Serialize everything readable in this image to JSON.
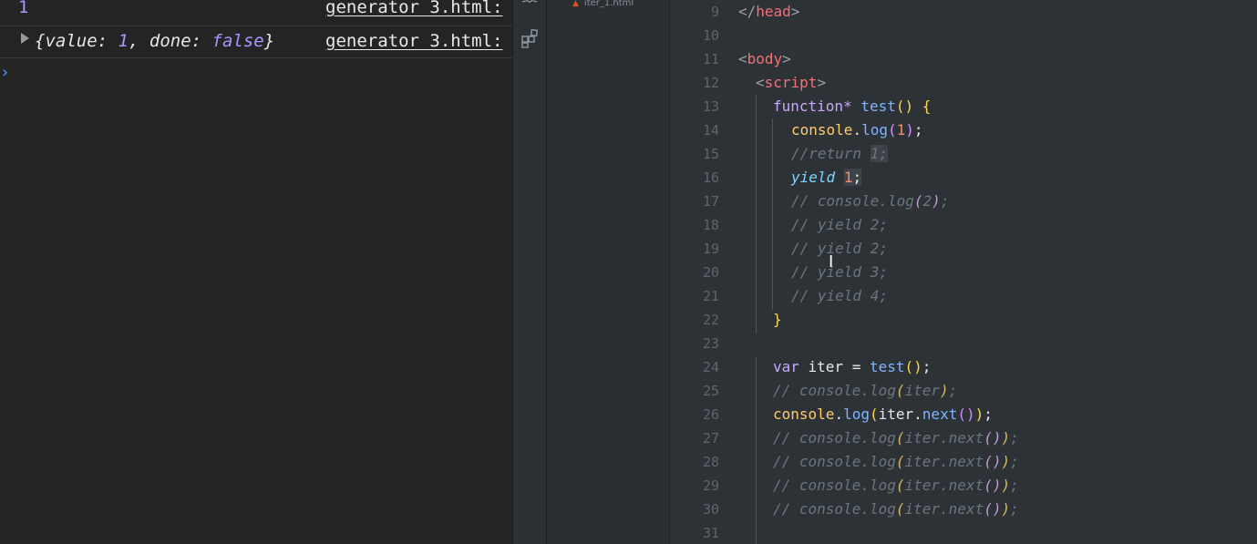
{
  "console": {
    "rows": [
      {
        "type": "number",
        "value": "1",
        "source": "generator 3.html:"
      },
      {
        "type": "object",
        "open": "{",
        "k1": "value: ",
        "v1": "1",
        "sep": ", ",
        "k2": "done: ",
        "v2": "false",
        "close": "}",
        "source": "generator 3.html:"
      }
    ],
    "prompt": "›"
  },
  "explorer": {
    "file_name": "iter_1.html",
    "file_icon": "html5-file-icon"
  },
  "activity_icons": [
    "debug-icon",
    "extensions-icon"
  ],
  "editor": {
    "line_numbers": [
      "9",
      "10",
      "11",
      "12",
      "13",
      "14",
      "15",
      "16",
      "17",
      "18",
      "19",
      "20",
      "21",
      "22",
      "23",
      "24",
      "25",
      "26",
      "27",
      "28",
      "29",
      "30",
      "31"
    ],
    "lines": {
      "l9": {
        "a": "</",
        "b": "head",
        "c": ">"
      },
      "l11": {
        "a": "<",
        "b": "body",
        "c": ">"
      },
      "l12": {
        "a": "<",
        "b": "script",
        "c": ">"
      },
      "l13": {
        "kw": "function* ",
        "fn": "test",
        "p": "()",
        "sp": " ",
        "br": "{"
      },
      "l14": {
        "obj": "console",
        "dot": ".",
        "fn": "log",
        "p1": "(",
        "n": "1",
        "p2": ")",
        "end": ";"
      },
      "l15": {
        "c": "//return ",
        "h": "1;"
      },
      "l16": {
        "y": "yield",
        "sp": " ",
        "n": "1",
        "end": ";"
      },
      "l17": {
        "c1": "// console.log",
        "p1": "(",
        "c2": "2",
        "p2": ")",
        "c3": ";"
      },
      "l18": {
        "c": "// yield 2;"
      },
      "l19": {
        "c": "// yield 2;"
      },
      "l20": {
        "c": "// yield 3;"
      },
      "l21": {
        "c": "// yield 4;"
      },
      "l22": {
        "br": "}"
      },
      "l24": {
        "kw": "var ",
        "v": "iter",
        "eq": " = ",
        "fn": "test",
        "p": "()",
        "end": ";"
      },
      "l25": {
        "c1": "// console.log",
        "p1": "(",
        "c2": "iter",
        "p2": ")",
        "c3": ";"
      },
      "l26": {
        "obj": "console",
        "dot": ".",
        "fn": "log",
        "p1": "(",
        "v": "iter",
        "dot2": ".",
        "fn2": "next",
        "p2": "()",
        "p3": ")",
        "end": ";"
      },
      "l27": {
        "c1": "// console.log",
        "p1": "(",
        "c2": "iter.next",
        "p2": "()",
        "p3": ")",
        "c3": ";"
      },
      "l28": {
        "c1": "// console.log",
        "p1": "(",
        "c2": "iter.next",
        "p2": "()",
        "p3": ")",
        "c3": ";"
      },
      "l29": {
        "c1": "// console.log",
        "p1": "(",
        "c2": "iter.next",
        "p2": "()",
        "p3": ")",
        "c3": ";"
      },
      "l30": {
        "c1": "// console.log",
        "p1": "(",
        "c2": "iter.next",
        "p2": "()",
        "p3": ")",
        "c3": ";"
      }
    }
  },
  "cursor_glyph": "I"
}
